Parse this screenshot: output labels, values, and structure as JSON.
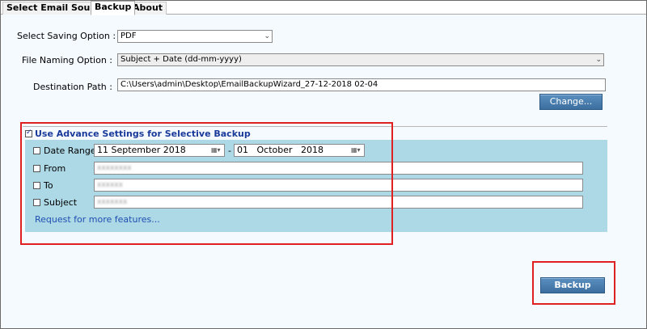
{
  "tabs": [
    {
      "label": "Select Email Source",
      "active": false
    },
    {
      "label": "Backup",
      "active": true
    },
    {
      "label": "About",
      "active": false
    }
  ],
  "saving_option": {
    "label": "Select Saving Option :",
    "value": "PDF"
  },
  "file_naming": {
    "label": "File Naming Option :",
    "value": "Subject + Date (dd-mm-yyyy)"
  },
  "destination": {
    "label": "Destination Path :",
    "value": "C:\\Users\\admin\\Desktop\\EmailBackupWizard_27-12-2018 02-04"
  },
  "change_button": "Change...",
  "advance": {
    "label": "Use Advance Settings for Selective Backup",
    "checked": true,
    "date_range": {
      "label": "Date Range",
      "checked": false,
      "from": "11 September 2018",
      "separator": "-",
      "to": "01   October   2018"
    },
    "from": {
      "label": "From",
      "checked": false,
      "value": "xxxxxxxx"
    },
    "to": {
      "label": "To",
      "checked": false,
      "value": "xxxxxx"
    },
    "subject": {
      "label": "Subject",
      "checked": false,
      "value": "xxxxxxx"
    },
    "request_link": "Request for more features..."
  },
  "backup_button": "Backup",
  "colors": {
    "panel": "#add8e6",
    "button": "#3c6f9f",
    "highlight": "#e02020",
    "link": "#1f4fb0"
  },
  "icons": {
    "dropdown": "chevron-down-icon",
    "calendar": "calendar-icon",
    "checkbox": "checkbox-icon"
  }
}
